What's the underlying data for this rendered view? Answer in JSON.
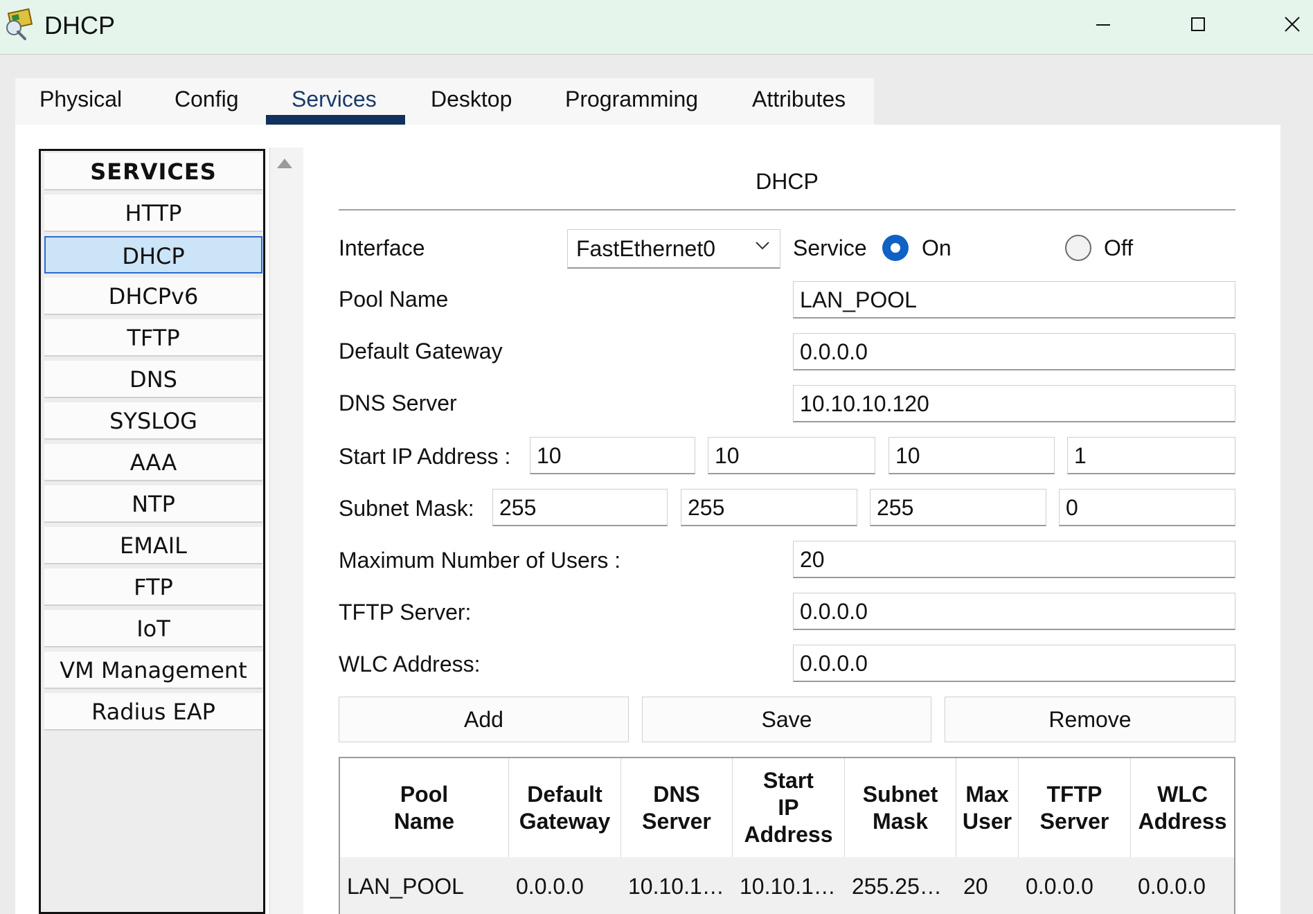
{
  "window": {
    "title": "DHCP"
  },
  "tabs": [
    "Physical",
    "Config",
    "Services",
    "Desktop",
    "Programming",
    "Attributes"
  ],
  "active_tab": "Services",
  "services": {
    "header": "SERVICES",
    "items": [
      "HTTP",
      "DHCP",
      "DHCPv6",
      "TFTP",
      "DNS",
      "SYSLOG",
      "AAA",
      "NTP",
      "EMAIL",
      "FTP",
      "IoT",
      "VM Management",
      "Radius EAP"
    ],
    "selected": "DHCP"
  },
  "dhcp": {
    "title": "DHCP",
    "interface_label": "Interface",
    "interface_value": "FastEthernet0",
    "service_label": "Service",
    "on_label": "On",
    "off_label": "Off",
    "service_state": "On",
    "pool_name_label": "Pool Name",
    "pool_name": "LAN_POOL",
    "gateway_label": "Default Gateway",
    "gateway": "0.0.0.0",
    "dns_label": "DNS Server",
    "dns": "10.10.10.120",
    "start_ip_label": "Start IP Address :",
    "start_ip": [
      "10",
      "10",
      "10",
      "1"
    ],
    "subnet_label": "Subnet Mask:",
    "subnet": [
      "255",
      "255",
      "255",
      "0"
    ],
    "max_users_label": "Maximum Number of Users :",
    "max_users": "20",
    "tftp_label": "TFTP Server:",
    "tftp": "0.0.0.0",
    "wlc_label": "WLC Address:",
    "wlc": "0.0.0.0",
    "buttons": {
      "add": "Add",
      "save": "Save",
      "remove": "Remove"
    }
  },
  "table": {
    "headers": [
      "Pool\nName",
      "Default\nGateway",
      "DNS\nServer",
      "Start\nIP\nAddress",
      "Subnet\nMask",
      "Max\nUser",
      "TFTP\nServer",
      "WLC\nAddress"
    ],
    "rows": [
      [
        "LAN_POOL",
        "0.0.0.0",
        "10.10.1…",
        "10.10.1…",
        "255.25…",
        "20",
        "0.0.0.0",
        "0.0.0.0"
      ]
    ]
  }
}
